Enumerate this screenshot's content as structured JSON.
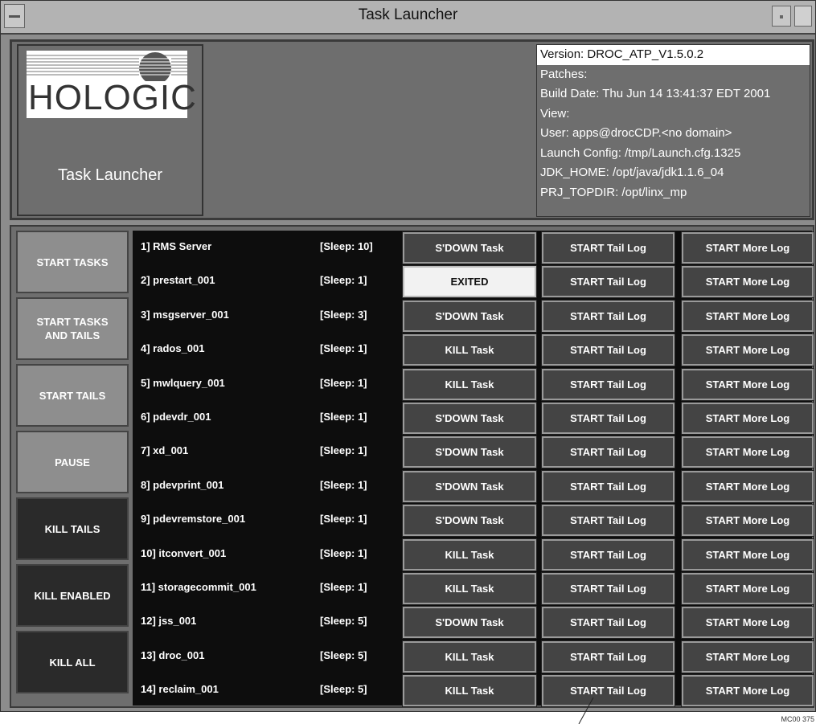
{
  "window": {
    "title": "Task Launcher"
  },
  "header": {
    "logo_text": "HOLOGIC",
    "app_title": "Task Launcher",
    "info": [
      "Version: DROC_ATP_V1.5.0.2",
      "Patches:",
      "Build Date: Thu Jun 14 13:41:37 EDT 2001",
      "View:",
      "User: apps@drocCDP.<no domain>",
      "Launch Config: /tmp/Launch.cfg.1325",
      "JDK_HOME: /opt/java/jdk1.1.6_04",
      "PRJ_TOPDIR: /opt/linx_mp"
    ]
  },
  "left_buttons": [
    {
      "label": "START TASKS",
      "style": "light"
    },
    {
      "label": "START TASKS\nAND TAILS",
      "style": "light"
    },
    {
      "label": "START TAILS",
      "style": "light"
    },
    {
      "label": "PAUSE",
      "style": "light"
    },
    {
      "label": "KILL TAILS",
      "style": "dark"
    },
    {
      "label": "KILL ENABLED",
      "style": "dark"
    },
    {
      "label": "KILL ALL",
      "style": "dark"
    }
  ],
  "tasks": [
    {
      "name": "1] RMS Server",
      "sleep": "[Sleep: 10]",
      "action": "S'DOWN Task",
      "tail": "START Tail Log",
      "more": "START More Log"
    },
    {
      "name": "2] prestart_001",
      "sleep": "[Sleep: 1]",
      "action": "EXITED",
      "tail": "START Tail Log",
      "more": "START More Log"
    },
    {
      "name": "3] msgserver_001",
      "sleep": "[Sleep: 3]",
      "action": "S'DOWN Task",
      "tail": "START Tail Log",
      "more": "START More Log"
    },
    {
      "name": "4] rados_001",
      "sleep": "[Sleep: 1]",
      "action": "KILL Task",
      "tail": "START Tail Log",
      "more": "START More Log"
    },
    {
      "name": "5] mwlquery_001",
      "sleep": "[Sleep: 1]",
      "action": "KILL Task",
      "tail": "START Tail Log",
      "more": "START More Log"
    },
    {
      "name": "6] pdevdr_001",
      "sleep": "[Sleep: 1]",
      "action": "S'DOWN Task",
      "tail": "START Tail Log",
      "more": "START More Log"
    },
    {
      "name": "7] xd_001",
      "sleep": "[Sleep: 1]",
      "action": "S'DOWN Task",
      "tail": "START Tail Log",
      "more": "START More Log"
    },
    {
      "name": "8] pdevprint_001",
      "sleep": "[Sleep: 1]",
      "action": "S'DOWN Task",
      "tail": "START Tail Log",
      "more": "START More Log"
    },
    {
      "name": "9] pdevremstore_001",
      "sleep": "[Sleep: 1]",
      "action": "S'DOWN Task",
      "tail": "START Tail Log",
      "more": "START More Log"
    },
    {
      "name": "10] itconvert_001",
      "sleep": "[Sleep: 1]",
      "action": "KILL Task",
      "tail": "START Tail Log",
      "more": "START More Log"
    },
    {
      "name": "11] storagecommit_001",
      "sleep": "[Sleep: 1]",
      "action": "KILL Task",
      "tail": "START Tail Log",
      "more": "START More Log"
    },
    {
      "name": "12] jss_001",
      "sleep": "[Sleep: 5]",
      "action": "S'DOWN Task",
      "tail": "START Tail Log",
      "more": "START More Log"
    },
    {
      "name": "13] droc_001",
      "sleep": "[Sleep: 5]",
      "action": "KILL Task",
      "tail": "START Tail Log",
      "more": "START More Log"
    },
    {
      "name": "14] reclaim_001",
      "sleep": "[Sleep: 5]",
      "action": "KILL Task",
      "tail": "START Tail Log",
      "more": "START More Log"
    }
  ],
  "figure_id": "MC00 375"
}
